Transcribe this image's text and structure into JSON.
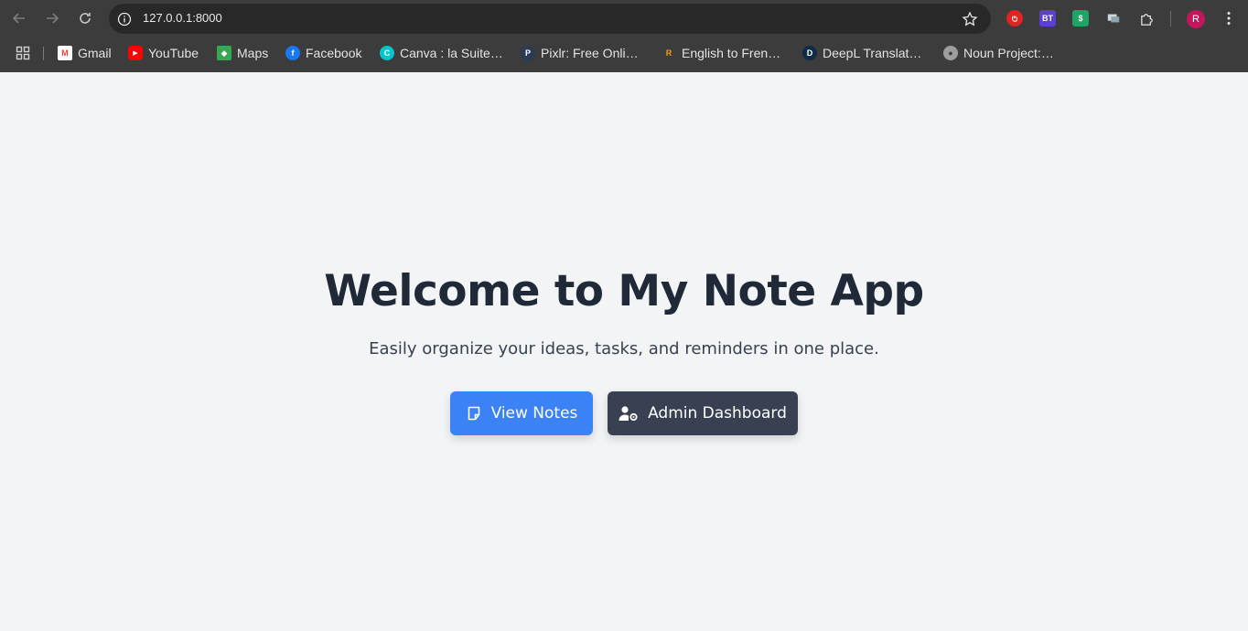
{
  "browser": {
    "url": "127.0.0.1:8000",
    "profile_initial": "R",
    "extensions": [
      {
        "name": "adblock-ext-icon",
        "label": "",
        "color": "#e02424"
      },
      {
        "name": "bt-ext-icon",
        "label": "BT",
        "color": "#5b3fd1"
      },
      {
        "name": "money-ext-icon",
        "label": "$",
        "color": "#21a366"
      },
      {
        "name": "screen-ext-icon",
        "label": "",
        "color": "#9aa3ad"
      }
    ]
  },
  "bookmarks": [
    {
      "label": "Gmail",
      "icon": "gmail-icon",
      "color": "#ea4335",
      "glyph": "M"
    },
    {
      "label": "YouTube",
      "icon": "youtube-icon",
      "color": "#ff0000",
      "glyph": "▶"
    },
    {
      "label": "Maps",
      "icon": "maps-icon",
      "color": "#34a853",
      "glyph": "◆"
    },
    {
      "label": "Facebook",
      "icon": "facebook-icon",
      "color": "#1877f2",
      "glyph": "f"
    },
    {
      "label": "Canva : la Suite…",
      "icon": "canva-icon",
      "color": "#00c4cc",
      "glyph": "C"
    },
    {
      "label": "Pixlr: Free Onli…",
      "icon": "pixlr-icon",
      "color": "#2b3a55",
      "glyph": "P"
    },
    {
      "label": "English to Fren…",
      "icon": "reverso-icon",
      "color": "#3c3c3c",
      "glyph": "R"
    },
    {
      "label": "DeepL Translat…",
      "icon": "deepl-icon",
      "color": "#0f2b46",
      "glyph": "D"
    },
    {
      "label": "Noun Project:…",
      "icon": "globe-icon",
      "color": "#9e9e9e",
      "glyph": "●"
    }
  ],
  "hero": {
    "title": "Welcome to My Note App",
    "subtitle": "Easily organize your ideas, tasks, and reminders in one place."
  },
  "actions": {
    "view_notes": "View Notes",
    "admin_dashboard": "Admin Dashboard"
  },
  "colors": {
    "primary": "#3b82f6",
    "dark": "#374151",
    "background": "#f3f4f6",
    "title": "#1f2937"
  }
}
